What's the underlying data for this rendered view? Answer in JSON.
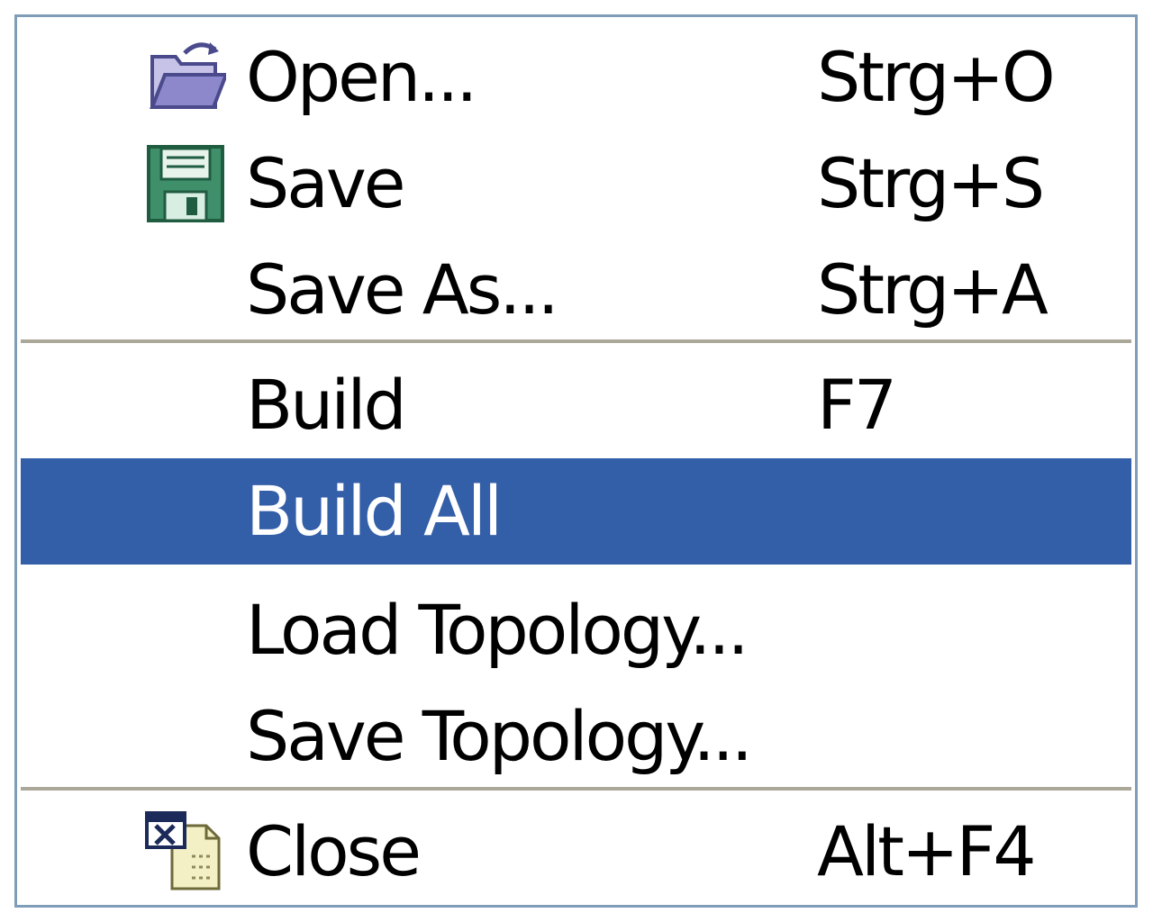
{
  "menu": {
    "items": [
      {
        "label": "Open...",
        "shortcut": "Strg+O",
        "icon": "open-folder-icon"
      },
      {
        "label": "Save",
        "shortcut": "Strg+S",
        "icon": "floppy-disk-icon"
      },
      {
        "label": "Save As...",
        "shortcut": "Strg+A"
      },
      {
        "label": "Build",
        "shortcut": "F7"
      },
      {
        "label": "Build All",
        "shortcut": "",
        "selected": true
      },
      {
        "label": "Load Topology...",
        "shortcut": ""
      },
      {
        "label": "Save Topology...",
        "shortcut": ""
      },
      {
        "label": "Close",
        "shortcut": "Alt+F4",
        "icon": "close-document-icon"
      }
    ]
  },
  "colors": {
    "border": "#7f9db9",
    "selection": "#335ea8",
    "separator": "#aca899"
  }
}
